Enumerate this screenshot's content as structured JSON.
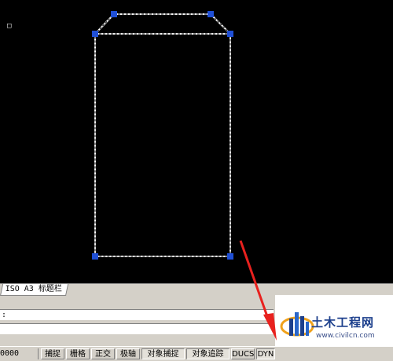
{
  "layout_tab": {
    "label": "ISO A3 标题栏"
  },
  "command": {
    "history_line": ":",
    "input_line": ""
  },
  "status": {
    "coordinates": "0000",
    "buttons": [
      {
        "label": "捕捉",
        "on": false
      },
      {
        "label": "栅格",
        "on": false
      },
      {
        "label": "正交",
        "on": false
      },
      {
        "label": "极轴",
        "on": false
      },
      {
        "label": "对象捕捉",
        "on": true
      },
      {
        "label": "对象追踪",
        "on": true
      },
      {
        "label": "DUCS",
        "on": false
      },
      {
        "label": "DYN",
        "on": true
      }
    ]
  },
  "logo": {
    "title": "土木工程网",
    "url": "www.civilcn.com"
  },
  "colors": {
    "canvas_bg": "#000000",
    "grip": "#1f4fd6",
    "highlight": "#ffffff",
    "arrow": "#e8211e"
  }
}
